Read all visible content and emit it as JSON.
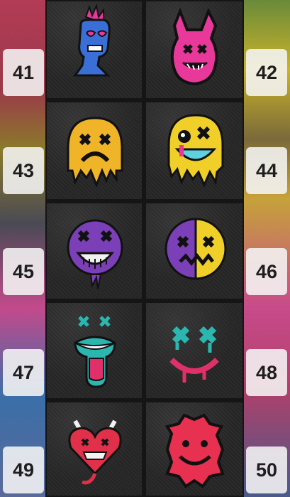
{
  "badges": [
    "41",
    "42",
    "43",
    "44",
    "45",
    "46",
    "47",
    "48",
    "49",
    "50"
  ],
  "items": [
    {
      "label": "41",
      "icon": "skull-flame-icon",
      "colors": [
        "#3a6fd8",
        "#e8389a"
      ]
    },
    {
      "label": "42",
      "icon": "bunny-skull-icon",
      "colors": [
        "#e8389a",
        "#111111"
      ]
    },
    {
      "label": "43",
      "icon": "dripping-sad-face-icon",
      "colors": [
        "#f0b428",
        "#111111"
      ]
    },
    {
      "label": "44",
      "icon": "melting-face-icon",
      "colors": [
        "#f0d028",
        "#5fd0e0",
        "#e8389a"
      ]
    },
    {
      "label": "45",
      "icon": "purple-skull-face-icon",
      "colors": [
        "#7b3fb8",
        "#f2f2f2"
      ]
    },
    {
      "label": "46",
      "icon": "split-face-icon",
      "colors": [
        "#7b3fb8",
        "#f0d028"
      ]
    },
    {
      "label": "47",
      "icon": "tongue-face-icon",
      "colors": [
        "#2bb6b0",
        "#e0306a"
      ]
    },
    {
      "label": "48",
      "icon": "drip-x-face-icon",
      "colors": [
        "#2bb6b0",
        "#e0306a"
      ]
    },
    {
      "label": "49",
      "icon": "devil-heart-icon",
      "colors": [
        "#e0304a",
        "#f2f2f2"
      ]
    },
    {
      "label": "50",
      "icon": "devil-smiley-icon",
      "colors": [
        "#e83050",
        "#111111"
      ]
    }
  ]
}
